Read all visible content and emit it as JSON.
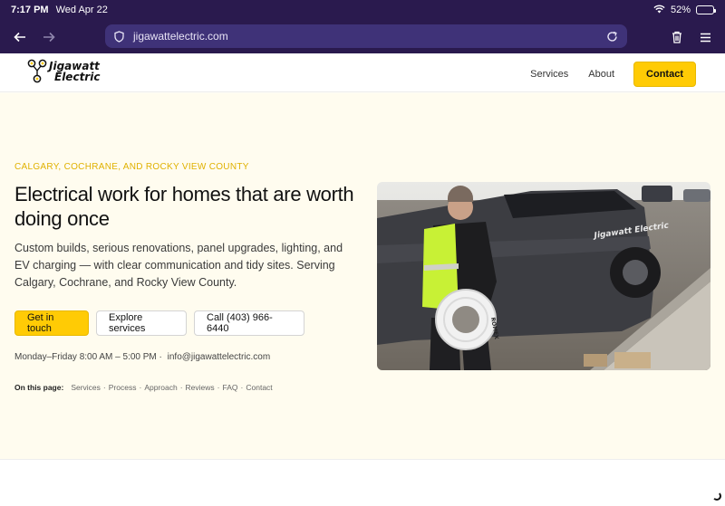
{
  "status": {
    "time": "7:17 PM",
    "date": "Wed Apr 22",
    "battery": "52%",
    "battery_level": 0.52
  },
  "browser": {
    "url": "jigawattelectric.com"
  },
  "site": {
    "logo": {
      "line1": "Jigawatt",
      "line2": "Electric"
    },
    "nav": [
      "Services",
      "About"
    ],
    "contact_label": "Contact"
  },
  "hero": {
    "eyebrow": "CALGARY, COCHRANE, AND ROCKY VIEW COUNTY",
    "headline": "Electrical work for homes that are worth doing once",
    "lede": "Custom builds, serious renovations, panel upgrades, lighting, and EV charging — with clear communication and tidy sites. Serving Calgary, Cochrane, and Rocky View County.",
    "buttons": {
      "primary": "Get in touch",
      "explore": "Explore services",
      "call": "Call (403) 966-6440"
    },
    "hours": "Monday–Friday 8:00 AM – 5:00 PM ·",
    "email": "info@jigawattelectric.com",
    "onpage_label": "On this page:",
    "onpage_links": [
      "Services",
      "Process",
      "Approach",
      "Reviews",
      "FAQ",
      "Contact"
    ],
    "photo_truck_text": "Jigawatt Electric",
    "photo_spool_text": "ROMEX"
  },
  "colors": {
    "brand_yellow": "#ffcb05",
    "browser_chrome": "#2a1a4e",
    "url_bar": "#3f3278"
  }
}
